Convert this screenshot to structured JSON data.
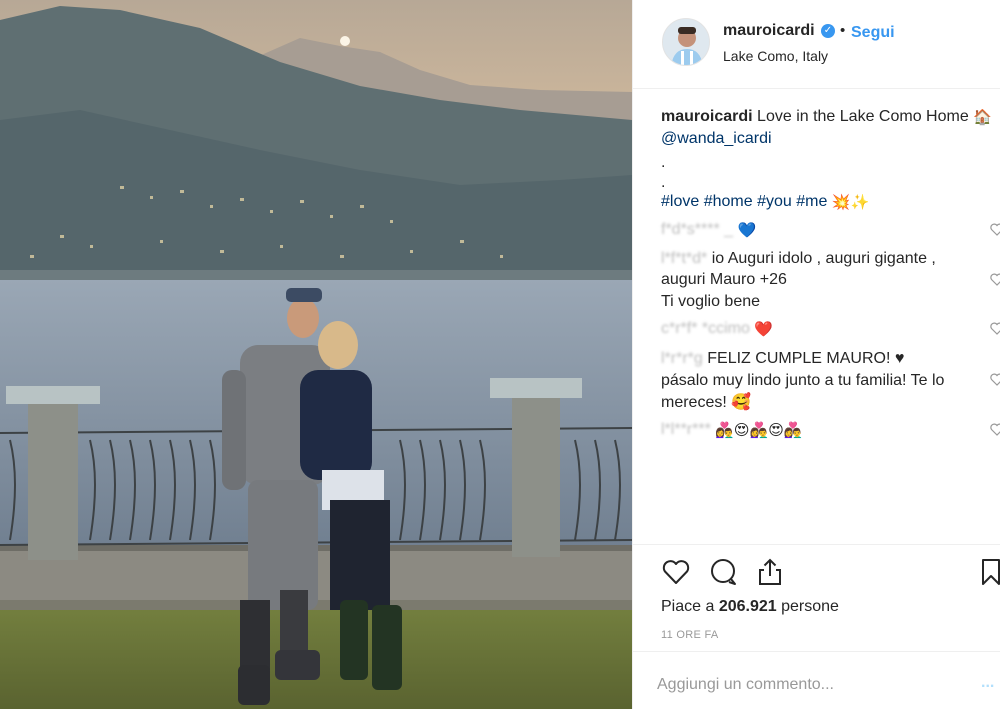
{
  "author": {
    "username": "mauroicardi",
    "verified_mark": "✓",
    "separator": "•",
    "follow_label": "Segui",
    "location": "Lake Como, Italy"
  },
  "caption": {
    "username": "mauroicardi",
    "text": "Love in the Lake Como Home",
    "emoji_home": "🏠",
    "mention": "@wanda_icardi",
    "dot1": ".",
    "dot2": ".",
    "hashtags": [
      "#love",
      "#home",
      "#you",
      "#me"
    ],
    "emoji_end": "💥✨"
  },
  "comments": [
    {
      "user_redacted": "f*d*s**** _",
      "lines": [
        "💙"
      ]
    },
    {
      "user_redacted": "l*f*t*d*",
      "lines": [
        "io Auguri idolo , auguri gigante ,",
        "auguri Mauro +26",
        "Ti voglio bene"
      ]
    },
    {
      "user_redacted": "c*r*f* *ccimo",
      "lines": [
        "❤️"
      ]
    },
    {
      "user_redacted": "l*r*r*g",
      "lines": [
        "FELIZ CUMPLE MAURO! ♥",
        "pásalo muy lindo junto a tu familia! Te lo",
        "mereces! 🥰"
      ]
    },
    {
      "user_redacted": "l*l**r***",
      "lines": [
        "👩‍❤️‍👨😍👩‍❤️‍👨😍👩‍❤️‍👨"
      ]
    }
  ],
  "icons": {
    "verified": "verified-badge-icon",
    "like": "heart-outline-icon",
    "comment": "speech-bubble-icon",
    "share": "share-upload-icon",
    "save": "bookmark-icon",
    "comment_like": "small-heart-icon"
  },
  "likes": {
    "prefix": "Piace a",
    "count": "206.921",
    "suffix": "persone"
  },
  "timestamp": "11 ORE FA",
  "comment_box": {
    "placeholder": "Aggiungi un commento...",
    "post_label": "..."
  },
  "colors": {
    "accent": "#3897f0",
    "text": "#262626",
    "muted": "#999999",
    "link": "#003569",
    "divider": "#efefef"
  }
}
